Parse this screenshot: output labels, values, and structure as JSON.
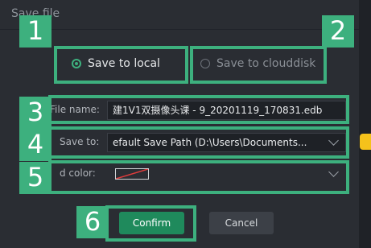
{
  "dialog": {
    "title": "Save file"
  },
  "save_location": {
    "local_label": "Save to local",
    "cloud_label": "Save to clouddisk",
    "selected": "local"
  },
  "file_name": {
    "label": "File name:",
    "value": "建1V1双摄像头课 - 9_20201119_170831.edb"
  },
  "save_to": {
    "label": "Save to:",
    "value": "efault Save Path (D:\\Users\\Documents..."
  },
  "board_color": {
    "label": "d color:",
    "value": "no color"
  },
  "buttons": {
    "confirm": "Confirm",
    "cancel": "Cancel"
  },
  "annotations": [
    "1",
    "2",
    "3",
    "4",
    "5",
    "6"
  ],
  "colors": {
    "accent": "#3db07e",
    "confirm_bg": "#1f8a5c",
    "swatch_slash": "#e03c3c",
    "folder_tab": "#f5c21b"
  }
}
